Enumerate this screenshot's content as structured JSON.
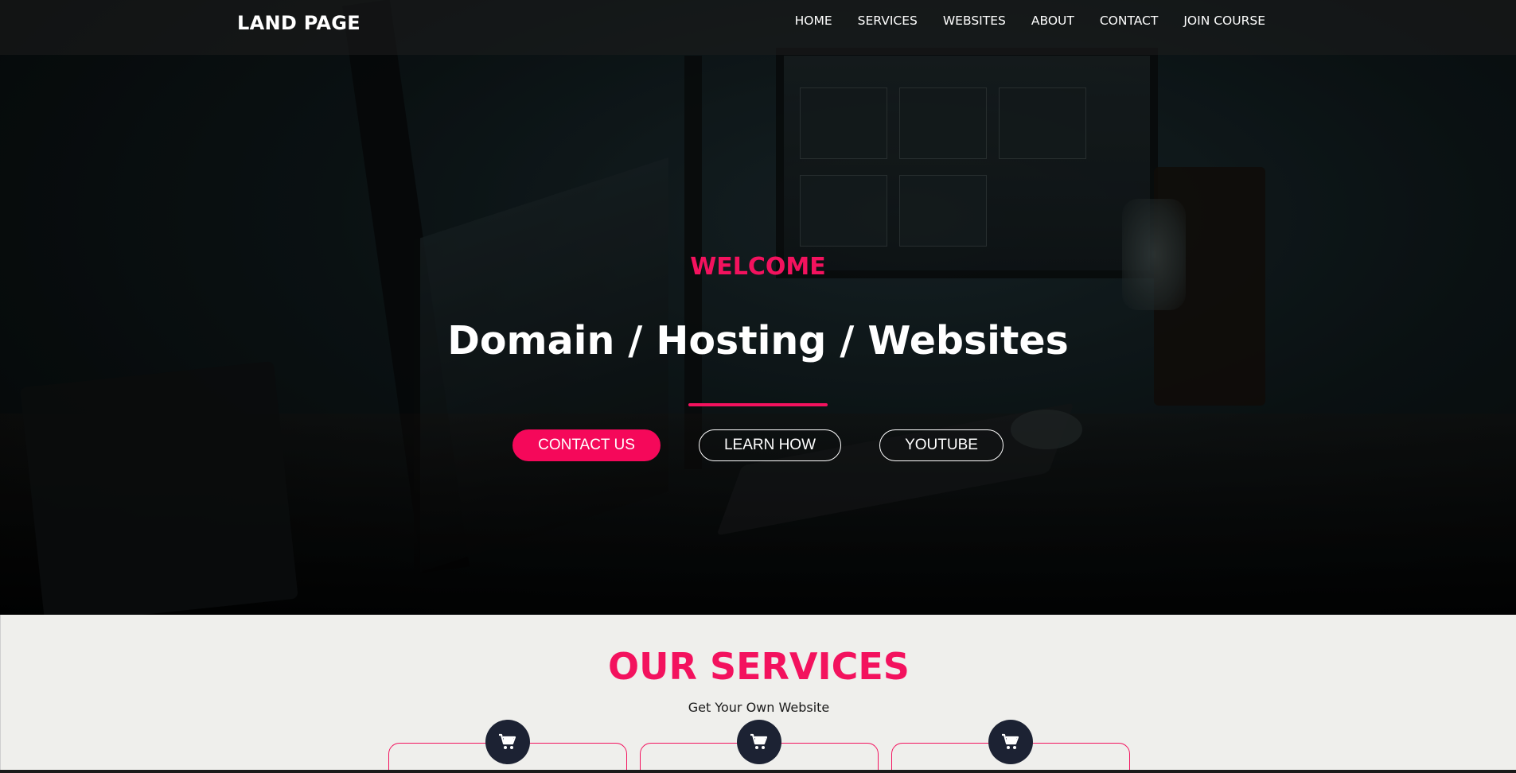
{
  "brand": {
    "logo": "LAND PAGE"
  },
  "nav": {
    "items": [
      {
        "label": "HOME"
      },
      {
        "label": "SERVICES"
      },
      {
        "label": "WEBSITES"
      },
      {
        "label": "ABOUT"
      },
      {
        "label": "CONTACT"
      },
      {
        "label": "JOIN COURSE"
      }
    ]
  },
  "hero": {
    "eyebrow": "WELCOME",
    "headline": "Domain / Hosting / Websites",
    "buttons": {
      "contact": "CONTACT US",
      "learn": "LEARN HOW",
      "youtube": "YOUTUBE"
    }
  },
  "services": {
    "title": "OUR SERVICES",
    "subtitle": "Get Your Own Website",
    "cards": [
      {
        "icon": "cart-icon"
      },
      {
        "icon": "cart-icon"
      },
      {
        "icon": "cart-icon"
      }
    ]
  },
  "colors": {
    "accent": "#f3125e",
    "icon_bg": "#1c2233",
    "section_bg": "#efefec"
  }
}
